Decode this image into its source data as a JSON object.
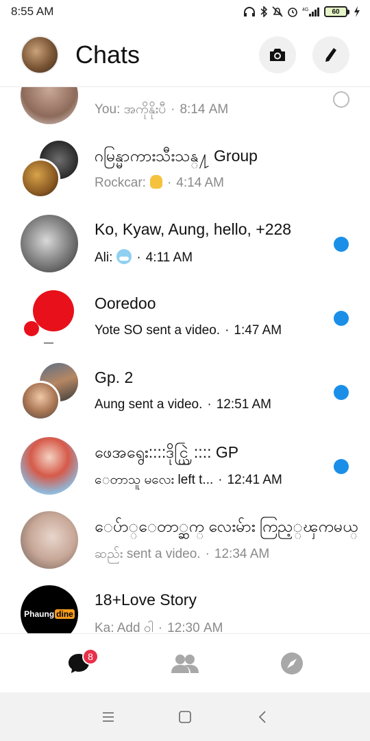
{
  "status_bar": {
    "time": "8:55 AM",
    "battery": "60",
    "network": "4G"
  },
  "header": {
    "title": "Chats",
    "camera_icon": "camera-icon",
    "compose_icon": "pencil-icon"
  },
  "chats": [
    {
      "name": "",
      "preview": "You: အကိုနိုးပီ",
      "time": "8:14 AM",
      "unread": false,
      "seen": true
    },
    {
      "name": "ဂမြန္မာကားသီးသန္႔ Group",
      "preview": "Rockcar:",
      "time": "4:14 AM",
      "unread": false,
      "emoji": "hand"
    },
    {
      "name": "Ko, Kyaw, Aung, hello, +228",
      "preview": "Ali:",
      "time": "4:11 AM",
      "unread": true,
      "emoji": "face"
    },
    {
      "name": "Ooredoo",
      "preview": "Yote SO sent a video.",
      "time": "1:47 AM",
      "unread": true
    },
    {
      "name": "Gp. 2",
      "preview": "Aung sent a video.",
      "time": "12:51 AM",
      "unread": true
    },
    {
      "name": "ဖေအရွေး::::ဒိုင္ယြဲ:::: GP",
      "preview": "ေတာသူ မလေး left t...",
      "time": "12:41 AM",
      "unread": true
    },
    {
      "name": "ေပ်ာ္ေတာ္ဆက္ လေးမ်ား ကြည့္ၾကမယ္",
      "preview": "ဆည်း sent a video.",
      "time": "12:34 AM",
      "unread": false
    },
    {
      "name": "18+Love Story",
      "preview": "Ka: Add ဝါ",
      "time": "12:30 AM",
      "unread": false,
      "avatar_text": [
        "Phaung",
        "dine"
      ]
    }
  ],
  "bottom_nav": {
    "chats_badge": "8",
    "items": [
      "chat-bubble-icon",
      "people-icon",
      "compass-icon"
    ]
  },
  "system_nav": [
    "menu-icon",
    "home-square-icon",
    "back-chevron-icon"
  ],
  "colors": {
    "unread_dot": "#1b8fe8",
    "badge": "#e8304a"
  }
}
